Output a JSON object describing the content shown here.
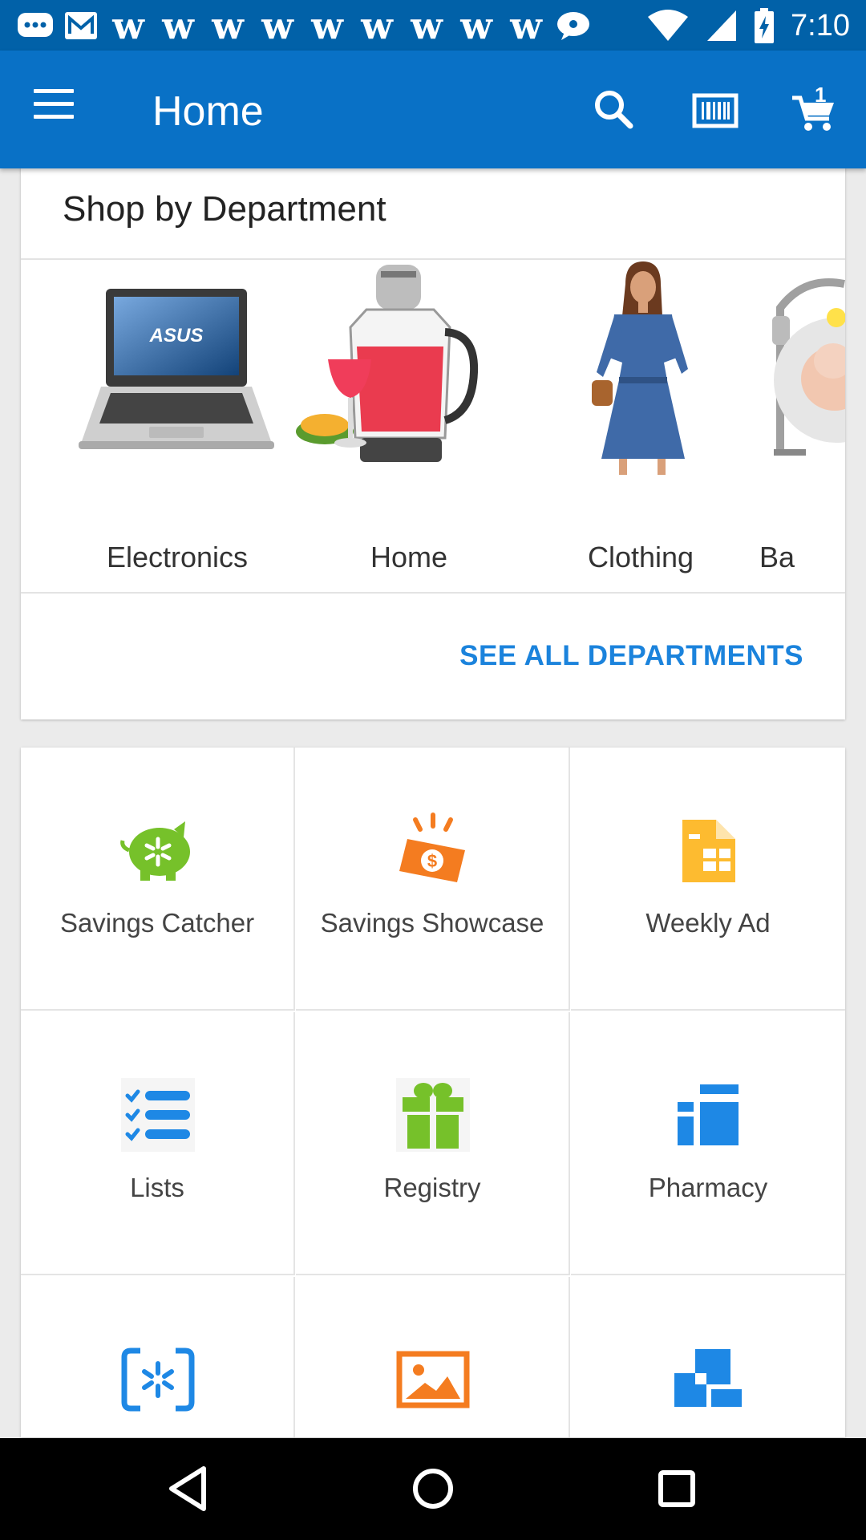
{
  "status_bar": {
    "time": "7:10",
    "notification_icons": [
      "chat-bubble-icon",
      "mail-icon",
      "w-app-icon",
      "w-app-icon",
      "w-app-icon",
      "w-app-icon",
      "w-app-icon",
      "w-app-icon",
      "w-app-icon",
      "w-app-icon",
      "w-app-icon",
      "message-icon"
    ],
    "notification_glyph": "w"
  },
  "app_bar": {
    "title": "Home",
    "actions": [
      "search-icon",
      "barcode-icon",
      "cart-icon"
    ],
    "cart_count": "1",
    "color": "#0971c6"
  },
  "departments": {
    "title": "Shop by Department",
    "items": [
      {
        "label": "Electronics",
        "icon": "laptop-image"
      },
      {
        "label": "Home",
        "icon": "blender-image"
      },
      {
        "label": "Clothing",
        "icon": "dress-image"
      },
      {
        "label": "Ba",
        "icon": "baby-swing-image"
      }
    ],
    "see_all_label": "SEE ALL DEPARTMENTS",
    "link_color": "#1b83dc"
  },
  "tiles": [
    {
      "label": "Savings Catcher",
      "icon": "piggy-bank-icon",
      "color": "#76c12a"
    },
    {
      "label": "Savings Showcase",
      "icon": "dollar-burst-icon",
      "color": "#f47c20"
    },
    {
      "label": "Weekly Ad",
      "icon": "weekly-ad-icon",
      "color": "#fdbb30"
    },
    {
      "label": "Lists",
      "icon": "checklist-icon",
      "color": "#1e88e5"
    },
    {
      "label": "Registry",
      "icon": "gift-icon",
      "color": "#76c12a"
    },
    {
      "label": "Pharmacy",
      "icon": "pharmacy-icon",
      "color": "#1e88e5"
    },
    {
      "label": "",
      "icon": "spark-scan-icon",
      "color": "#1e88e5"
    },
    {
      "label": "",
      "icon": "photo-icon",
      "color": "#f47c20"
    },
    {
      "label": "",
      "icon": "stacked-blocks-icon",
      "color": "#1e88e5"
    }
  ],
  "nav_bar": {
    "buttons": [
      "back-icon",
      "home-circle-icon",
      "recents-icon"
    ]
  }
}
